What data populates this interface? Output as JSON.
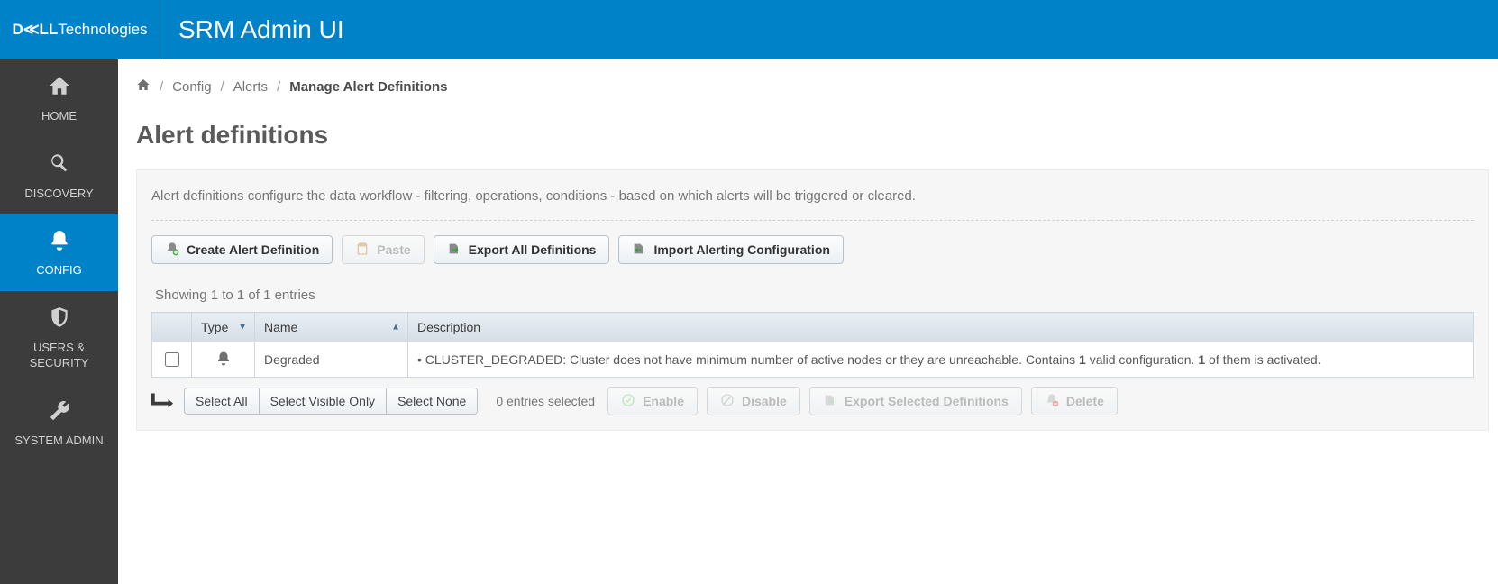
{
  "brand": {
    "logo_bold": "D≪LL",
    "logo_rest": "Technologies",
    "app_title": "SRM Admin UI"
  },
  "sidebar": {
    "items": [
      {
        "label": "HOME"
      },
      {
        "label": "DISCOVERY"
      },
      {
        "label": "CONFIG"
      },
      {
        "label": "USERS & SECURITY"
      },
      {
        "label": "SYSTEM ADMIN"
      }
    ]
  },
  "breadcrumb": {
    "c1": "Config",
    "c2": "Alerts",
    "c3": "Manage Alert Definitions"
  },
  "page": {
    "title": "Alert definitions"
  },
  "panel": {
    "description": "Alert definitions configure the data workflow - filtering, operations, conditions - based on which alerts will be triggered or cleared."
  },
  "toolbar": {
    "create": "Create Alert Definition",
    "paste": "Paste",
    "export_all": "Export All Definitions",
    "import": "Import Alerting Configuration"
  },
  "table": {
    "showing": "Showing 1 to 1 of 1 entries",
    "headers": {
      "type": "Type",
      "name": "Name",
      "description": "Description"
    },
    "rows": [
      {
        "name": "Degraded",
        "desc_pre": "• CLUSTER_DEGRADED: Cluster does not have minimum number of active nodes or they are unreachable. Contains ",
        "desc_b1": "1",
        "desc_mid": " valid configuration. ",
        "desc_b2": "1",
        "desc_post": " of them is activated."
      }
    ]
  },
  "footer": {
    "select_all": "Select All",
    "select_visible": "Select Visible Only",
    "select_none": "Select None",
    "selected_count": "0 entries selected",
    "enable": "Enable",
    "disable": "Disable",
    "export_selected": "Export Selected Definitions",
    "delete": "Delete"
  }
}
